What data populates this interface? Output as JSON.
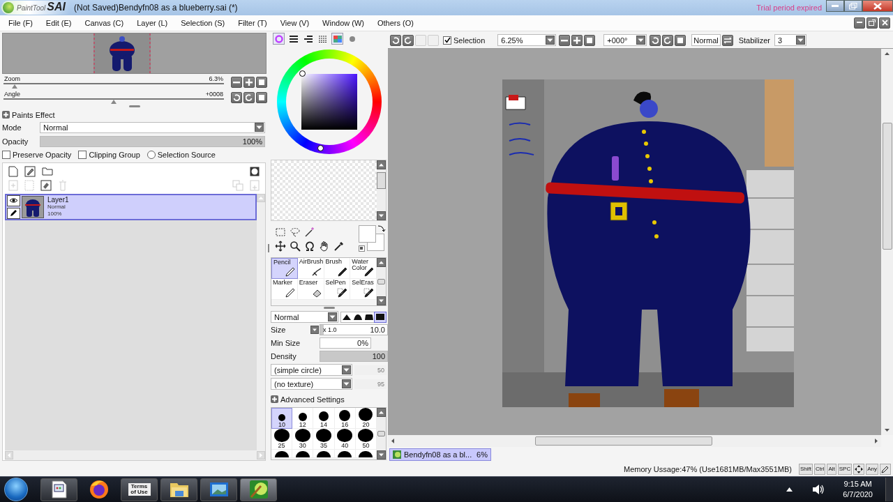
{
  "window": {
    "logo_word": "PaintTool",
    "logo_mark": "SAI",
    "title": "(Not Saved)Bendyfn08 as a blueberry.sai (*)",
    "notice": "Trial period expired"
  },
  "menu": [
    "File (F)",
    "Edit (E)",
    "Canvas (C)",
    "Layer (L)",
    "Selection (S)",
    "Filter (T)",
    "View (V)",
    "Window (W)",
    "Others (O)"
  ],
  "navigator": {
    "zoom": {
      "label": "Zoom",
      "value": "6.3%",
      "level": 0.05
    },
    "angle": {
      "label": "Angle",
      "value": "+0008",
      "level": 0.5
    }
  },
  "paints_effect": "Paints Effect",
  "mode": {
    "label": "Mode",
    "value": "Normal"
  },
  "opacity": {
    "label": "Opacity",
    "value": "100%",
    "level": 1
  },
  "layer_options": [
    {
      "kind": "checkbox",
      "label": "Preserve Opacity",
      "checked": false
    },
    {
      "kind": "checkbox",
      "label": "Clipping Group",
      "checked": false
    },
    {
      "kind": "radio",
      "label": "Selection Source",
      "checked": false
    }
  ],
  "layers": [
    {
      "name": "Layer1",
      "mode": "Normal",
      "opacity": "100%",
      "selected": true,
      "visible": true
    }
  ],
  "brushes": [
    {
      "label": "Pencil",
      "selected": true
    },
    {
      "label": "AirBrush",
      "selected": false
    },
    {
      "label": "Brush",
      "selected": false
    },
    {
      "label": "Water Color",
      "selected": false
    },
    {
      "label": "Marker",
      "selected": false
    },
    {
      "label": "Eraser",
      "selected": false
    },
    {
      "label": "SelPen",
      "selected": false
    },
    {
      "label": "SelEras",
      "selected": false
    }
  ],
  "brush_settings": {
    "blend": "Normal",
    "shapes": [
      {
        "selected": false
      },
      {
        "selected": false
      },
      {
        "selected": false
      },
      {
        "selected": true
      }
    ],
    "size": {
      "label": "Size",
      "multiplier": "x 1.0",
      "value": "10.0",
      "level": 0.05
    },
    "min_size": {
      "label": "Min Size",
      "value": "0%",
      "level": 0
    },
    "density": {
      "label": "Density",
      "value": "100",
      "level": 1
    },
    "shape": "(simple circle)",
    "shape_value": "50",
    "texture": "(no texture)",
    "texture_value": "95",
    "advanced": "Advanced Settings"
  },
  "brush_sizes": [
    {
      "label": "10",
      "selected": true
    },
    {
      "label": "12",
      "selected": false
    },
    {
      "label": "14",
      "selected": false
    },
    {
      "label": "16",
      "selected": false
    },
    {
      "label": "20",
      "selected": false
    },
    {
      "label": "25",
      "selected": false
    },
    {
      "label": "30",
      "selected": false
    },
    {
      "label": "35",
      "selected": false
    },
    {
      "label": "40",
      "selected": false
    },
    {
      "label": "50",
      "selected": false
    }
  ],
  "canvas_toolbar": {
    "selection_label": "Selection",
    "selection_checked": true,
    "zoom": "6.25%",
    "angle": "+000°",
    "blend": "Normal",
    "stabilizer_label": "Stabilizer",
    "stabilizer": "3"
  },
  "documents": [
    {
      "name": "Bendyfn08 as a bl...",
      "zoom": "6%",
      "selected": true
    }
  ],
  "status_bar": {
    "memory": "Memory Ussage:47% (Use1681MB/Max3551MB)",
    "keys": [
      "Shift",
      "Ctrl",
      "Alt",
      "SPC"
    ],
    "any_key": "Any"
  },
  "taskbar": {
    "terms_tile": "Terms of Use",
    "time": "9:15 AM",
    "date": "6/7/2020"
  }
}
